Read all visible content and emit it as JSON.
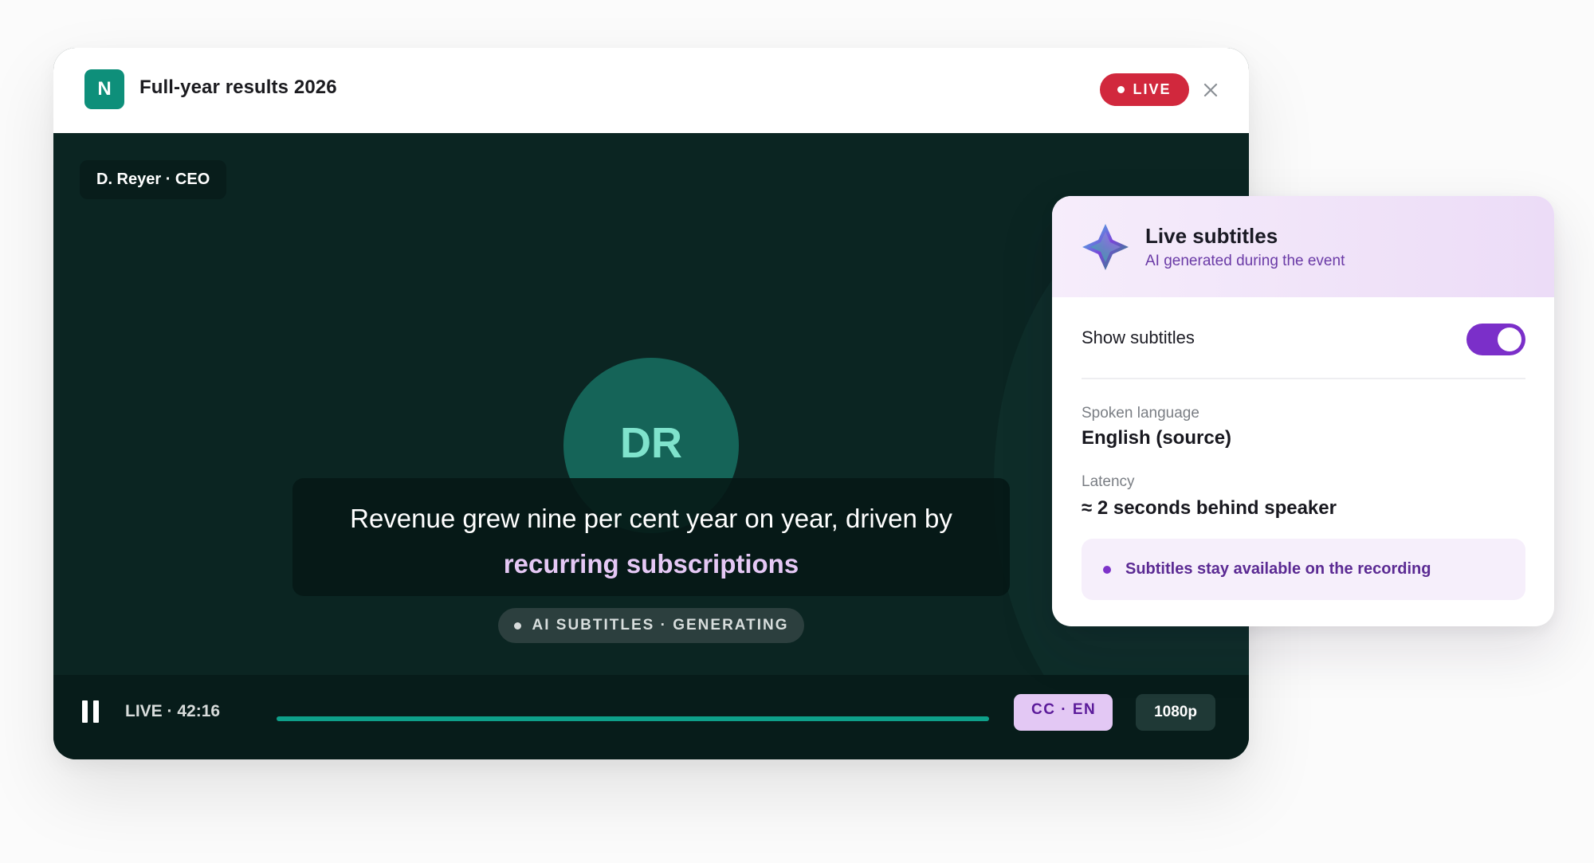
{
  "player": {
    "app_logo_letter": "N",
    "event_title": "Full-year results 2026",
    "live_badge": "LIVE",
    "speaker_tag": "D. Reyer · CEO",
    "avatar_initials": "DR",
    "caption_line1": "Revenue grew nine per cent year on year, driven by",
    "caption_line2": "recurring subscriptions",
    "generating_status": "AI SUBTITLES · GENERATING",
    "live_time": "LIVE · 42:16",
    "progress_percent": 100,
    "cc_label": "CC · EN",
    "quality_label": "1080p"
  },
  "subtitles_panel": {
    "title": "Live subtitles",
    "subtitle": "AI generated during the event",
    "show_subtitles_label": "Show subtitles",
    "show_subtitles_on": true,
    "spoken_language_label": "Spoken language",
    "spoken_language_value": "English (source)",
    "latency_label": "Latency",
    "latency_value": "≈ 2 seconds behind speaker",
    "note": "Subtitles stay available on the recording"
  },
  "icons": {
    "close": "close-icon",
    "pause": "pause-icon",
    "spark": "sparkle-icon"
  },
  "colors": {
    "brand_green": "#0e8f7a",
    "live_red": "#d1283d",
    "accent_purple": "#7b2fc9",
    "stage_bg": "#0b2522"
  }
}
